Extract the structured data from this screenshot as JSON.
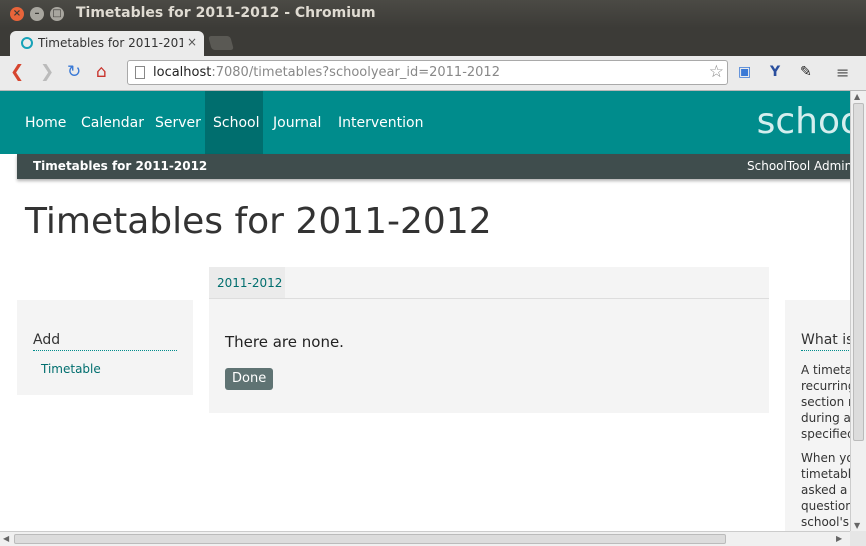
{
  "window": {
    "title": "Timetables for 2011-2012 - Chromium"
  },
  "tab": {
    "title": "Timetables for 2011-2012",
    "close": "×"
  },
  "toolbar": {
    "url_host": "localhost",
    "url_rest": ":7080/timetables?schoolyear_id=2011-2012"
  },
  "nav": {
    "items": [
      "Home",
      "Calendar",
      "Server",
      "School",
      "Journal",
      "Intervention"
    ],
    "active": "School",
    "brand": "schoo"
  },
  "subbar": {
    "breadcrumb": "Timetables for 2011-2012",
    "user": "SchoolTool Adminis"
  },
  "page": {
    "title": "Timetables for 2011-2012"
  },
  "left_panel": {
    "heading": "Add",
    "link": "Timetable"
  },
  "main": {
    "year_tab": "2011-2012",
    "empty_message": "There are none.",
    "done_label": "Done"
  },
  "right_panel": {
    "heading": "What is",
    "para1": [
      "A timetal",
      "recurring",
      "section n",
      "during a",
      "specified"
    ],
    "para2": [
      "When yo",
      "timetable",
      "asked a s",
      "question",
      "school's s"
    ]
  },
  "colors": {
    "nav": "#008c8c",
    "nav_active": "#006e6e",
    "subbar": "#3f4d4d"
  }
}
